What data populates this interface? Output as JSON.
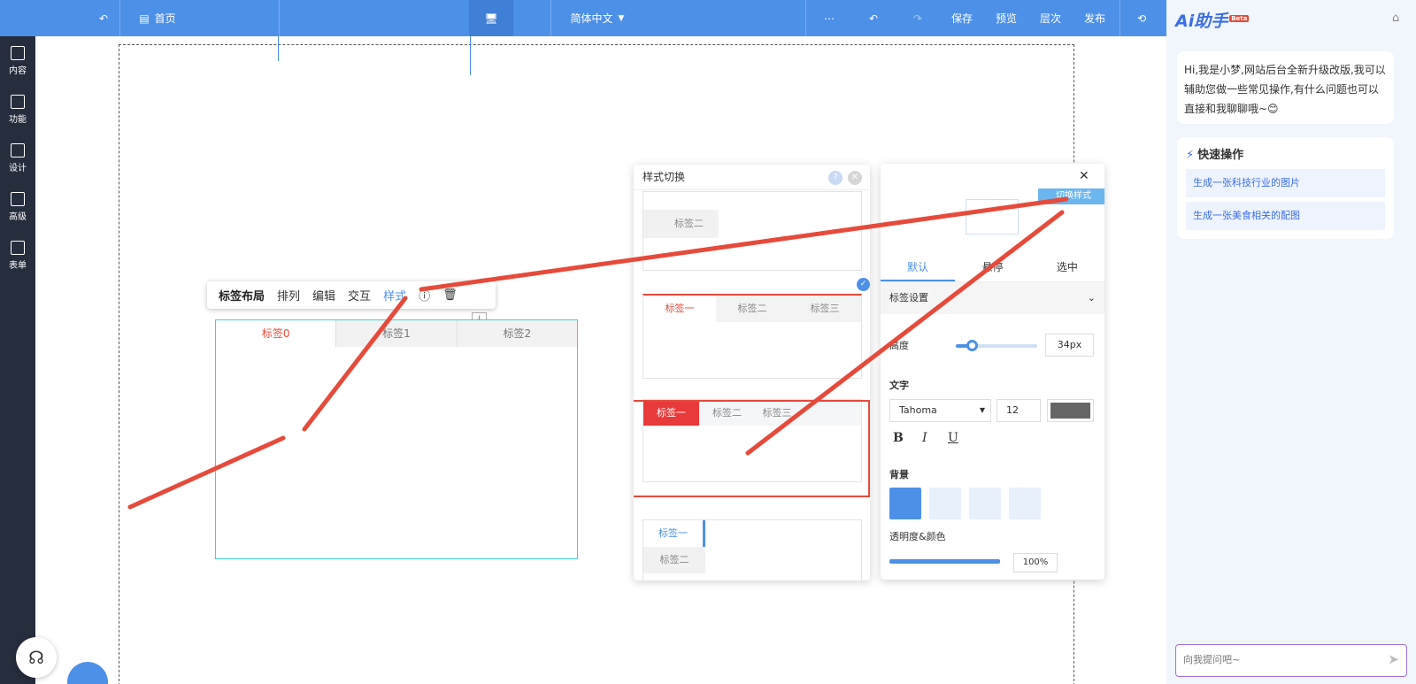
{
  "topbar": {
    "home_label": "首页",
    "language": "简体中文",
    "save": "保存",
    "preview": "预览",
    "layers": "层次",
    "publish": "发布"
  },
  "leftnav": {
    "items": [
      {
        "label": "内容",
        "icon": "document-icon"
      },
      {
        "label": "功能",
        "icon": "grid-icon"
      },
      {
        "label": "设计",
        "icon": "layout-icon"
      },
      {
        "label": "高级",
        "icon": "code-icon"
      },
      {
        "label": "表单",
        "icon": "form-icon"
      }
    ]
  },
  "toolbar": {
    "layout": "标签布局",
    "arrange": "排列",
    "edit": "编辑",
    "interact": "交互",
    "style": "样式"
  },
  "tabwidget": {
    "tabs": [
      "标签0",
      "标签1",
      "标签2"
    ]
  },
  "style_switch": {
    "title": "样式切换",
    "tab1": "标签一",
    "tab2": "标签二",
    "tab3": "标签三",
    "vtab_top": "标签一"
  },
  "props": {
    "switch_style": "切换样式",
    "states": [
      "默认",
      "悬停",
      "选中"
    ],
    "section": "标签设置",
    "height_label": "高度",
    "height_value": "34px",
    "height_level": 0.2,
    "text_label": "文字",
    "font": "Tahoma",
    "font_size": "12",
    "text_color": "#666666",
    "bold": "B",
    "italic": "I",
    "underline": "U",
    "bg_label": "背景",
    "opacity_label": "透明度&颜色",
    "opacity_value": "100%"
  },
  "ai": {
    "brand": "Ai助手",
    "badge": "Beta",
    "greeting": "Hi,我是小梦,网站后台全新升级改版,我可以辅助您做一些常见操作,有什么问题也可以直接和我聊聊哦~😊",
    "quick_title": "快速操作",
    "quick_items": [
      "生成一张科技行业的图片",
      "生成一张美食相关的配图"
    ],
    "input_placeholder": "向我提问吧~"
  },
  "colors": {
    "accent": "#4d90e8",
    "nav_bg": "#262d3d",
    "red": "#e83a3a",
    "cyan": "#3ad3d3"
  }
}
